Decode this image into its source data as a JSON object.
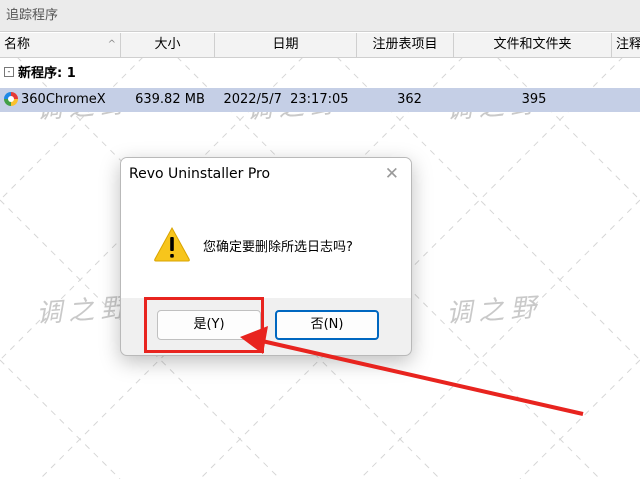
{
  "panel": {
    "title": "追踪程序"
  },
  "columns": [
    {
      "label": "名称"
    },
    {
      "label": "大小"
    },
    {
      "label": "日期"
    },
    {
      "label": "注册表项目"
    },
    {
      "label": "文件和文件夹"
    },
    {
      "label": "注释"
    }
  ],
  "group": {
    "toggle": "-",
    "label": "新程序: 1"
  },
  "row": {
    "name": "360ChromeX",
    "size": "639.82 MB",
    "date": "2022/5/7",
    "time": "23:17:05",
    "registry": "362",
    "files": "395"
  },
  "watermark": {
    "text": "调之野"
  },
  "dialog": {
    "title": "Revo Uninstaller Pro",
    "close": "✕",
    "message": "您确定要删除所选日志吗?",
    "yes_label": "是(Y)",
    "no_label": "否(N)"
  },
  "colors": {
    "highlight_row": "#c5cfe6",
    "annotation_red": "#e8241f",
    "default_button_border": "#0067c0",
    "warning_yellow": "#f7c51c"
  },
  "icons": {
    "app": "360chrome-icon",
    "warning": "warning-icon",
    "close": "close-icon"
  }
}
